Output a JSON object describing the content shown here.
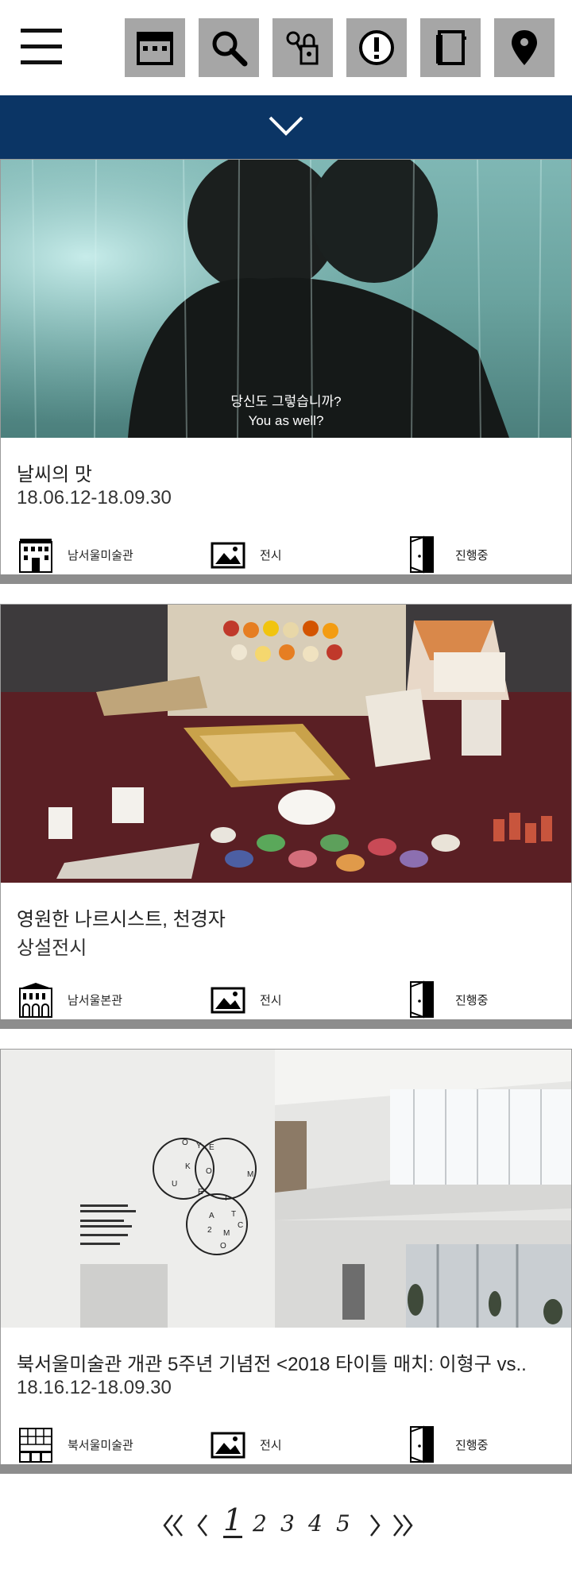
{
  "header": {
    "icons": [
      "calendar-icon",
      "search-icon",
      "lock-key-icon",
      "notice-icon",
      "notebook-icon",
      "location-pin-icon"
    ]
  },
  "hero_caption": {
    "line1": "당신도 그렇습니까?",
    "line2": "You as well?"
  },
  "cards": [
    {
      "title": "날씨의 맛",
      "subtitle": "18.06.12-18.09.30",
      "venue": "남서울미술관",
      "type": "전시",
      "status": "진행중"
    },
    {
      "title": "영원한 나르시스트, 천경자",
      "subtitle": "상설전시",
      "venue": "남서울본관",
      "type": "전시",
      "status": "진행중"
    },
    {
      "title": "북서울미술관 개관 5주년 기념전 <2018 타이틀 매치: 이형구 vs..",
      "subtitle": "18.16.12-18.09.30",
      "venue": "북서울미술관",
      "type": "전시",
      "status": "진행중"
    }
  ],
  "pagination": {
    "pages": [
      "1",
      "2",
      "3",
      "4",
      "5"
    ],
    "current": "1"
  },
  "colors": {
    "nav_band": "#0b3565",
    "icon_button": "#a6a6a6"
  }
}
